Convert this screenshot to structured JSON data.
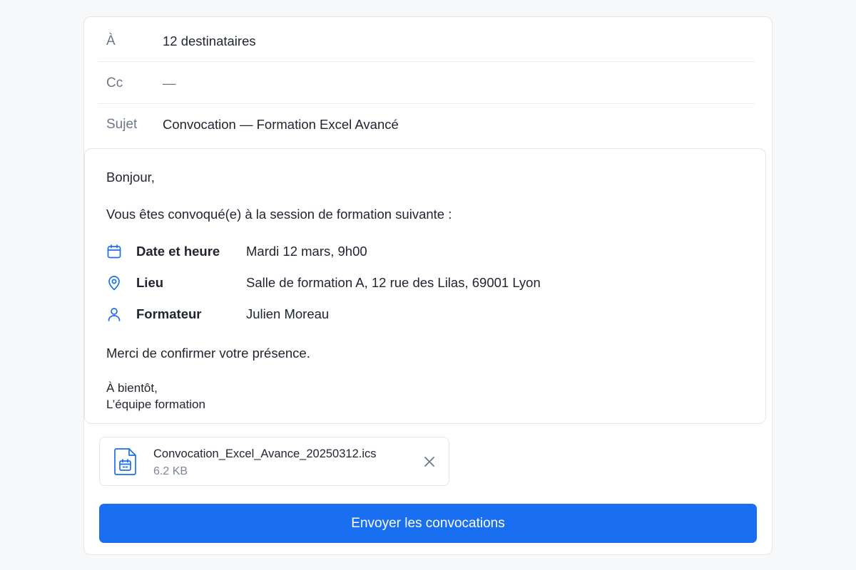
{
  "header": {
    "to": {
      "label": "À",
      "value": "12 destinataires"
    },
    "cc": {
      "label": "Cc",
      "value": "—"
    },
    "subject": {
      "label": "Sujet",
      "value": "Convocation — Formation Excel Avancé"
    }
  },
  "body": {
    "greeting": "Bonjour,",
    "intro": "Vous êtes convoqué(e) à la session de formation suivante :",
    "details": [
      {
        "icon": "calendar-icon",
        "label": "Date et heure",
        "value": "Mardi 12 mars, 9h00"
      },
      {
        "icon": "location-pin-icon",
        "label": "Lieu",
        "value": "Salle de formation A, 12 rue des Lilas, 69001 Lyon"
      },
      {
        "icon": "person-icon",
        "label": "Formateur",
        "value": "Julien Moreau"
      }
    ],
    "closing": "Merci de confirmer votre présence.",
    "signoff_line1": "À bientôt,",
    "signoff_line2": "L’équipe formation"
  },
  "attachment": {
    "icon": "calendar-file-icon",
    "name": "Convocation_Excel_Avance_20250312.ics",
    "size": "6.2 KB"
  },
  "actions": {
    "send_label": "Envoyer les convocations"
  },
  "colors": {
    "accent": "#1a6ff0",
    "icon": "#1a6ff0",
    "label_muted": "#6e778a"
  }
}
